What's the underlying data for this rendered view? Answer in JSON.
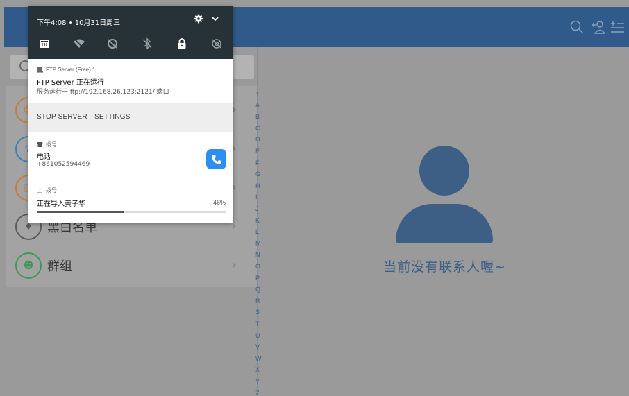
{
  "status_bar": {
    "time_date": "下午4:08 • 10月31日周三"
  },
  "quick_settings": {
    "tiles": [
      "ethernet-icon",
      "wifi-off-icon",
      "data-saver-icon",
      "bluetooth-off-icon",
      "lock-icon",
      "location-off-icon"
    ]
  },
  "notifications": {
    "ftp": {
      "app_name": "FTP Server (Free) ^",
      "title": "FTP Server 正在运行",
      "text": "服务运行于 ftp://192.168.26.123:2121/ 端口",
      "actions": [
        "STOP SERVER",
        "SETTINGS"
      ]
    },
    "dialer": {
      "app_name": "拨号",
      "title": "电话",
      "text": "+861052594469"
    },
    "import": {
      "app_name": "拨号",
      "title": "正在导入黄子华",
      "percent_label": "46%",
      "progress": 0.46
    }
  },
  "contacts_app": {
    "menu_rows": [
      {
        "label": "",
        "color": "#d4843a"
      },
      {
        "label": "",
        "color": "#3a7fc2"
      },
      {
        "label": "",
        "color": "#d4843a"
      },
      {
        "label": "黑白名单",
        "color": "#5a5a5a"
      },
      {
        "label": "群组",
        "color": "#3c9a55"
      }
    ],
    "alphabet": [
      "↑",
      "A",
      "B",
      "C",
      "D",
      "E",
      "F",
      "G",
      "H",
      "I",
      "J",
      "K",
      "L",
      "M",
      "N",
      "O",
      "P",
      "Q",
      "R",
      "S",
      "T",
      "U",
      "V",
      "W",
      "X",
      "Y",
      "Z"
    ],
    "empty_message": "当前没有联系人喔~"
  }
}
